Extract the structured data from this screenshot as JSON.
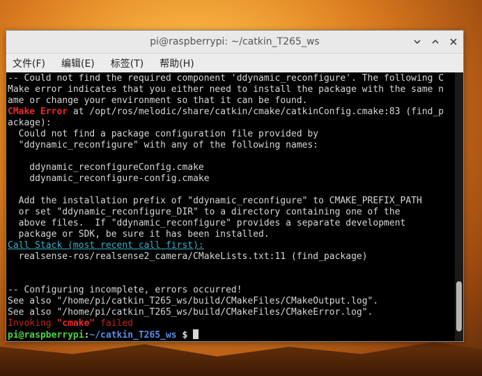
{
  "window": {
    "title": "pi@raspberrypi: ~/catkin_T265_ws",
    "controls": [
      "minimize-icon",
      "maximize-icon",
      "close-icon"
    ]
  },
  "menu": {
    "file": "文件(F)",
    "edit": "编辑(E)",
    "tabs": "标签(T)",
    "help": "帮助(H)"
  },
  "terminal": {
    "l1": "-- Could not find the required component 'ddynamic_reconfigure'. The following C",
    "l2": "Make error indicates that you either need to install the package with the same n",
    "l3": "ame or change your environment so that it can be found.",
    "l4_a": "CMake Error",
    "l4_b": " at /opt/ros/melodic/share/catkin/cmake/catkinConfig.cmake:83 (find_p",
    "l5": "ackage):",
    "l6": "  Could not find a package configuration file provided by",
    "l7": "  \"ddynamic_reconfigure\" with any of the following names:",
    "l8": "",
    "l9": "    ddynamic_reconfigureConfig.cmake",
    "l10": "    ddynamic_reconfigure-config.cmake",
    "l11": "",
    "l12": "  Add the installation prefix of \"ddynamic_reconfigure\" to CMAKE_PREFIX_PATH",
    "l13": "  or set \"ddynamic_reconfigure_DIR\" to a directory containing one of the",
    "l14": "  above files.  If \"ddynamic_reconfigure\" provides a separate development",
    "l15": "  package or SDK, be sure it has been installed.",
    "l16": "Call Stack (most recent call first):",
    "l17": "  realsense-ros/realsense2_camera/CMakeLists.txt:11 (find_package)",
    "l18": "",
    "l19": "",
    "l20": "-- Configuring incomplete, errors occurred!",
    "l21": "See also \"/home/pi/catkin_T265_ws/build/CMakeFiles/CMakeOutput.log\".",
    "l22": "See also \"/home/pi/catkin_T265_ws/build/CMakeFiles/CMakeError.log\".",
    "l23_a": "Invoking ",
    "l23_b": "\"cmake\"",
    "l23_c": " failed",
    "prompt_user": "pi@raspberrypi",
    "prompt_colon": ":",
    "prompt_path": "~/catkin_T265_ws",
    "prompt_symbol": " $ "
  },
  "colors": {
    "error_red": "#ef2929",
    "link_cyan": "#34b2c9",
    "prompt_green": "#4fd43d",
    "prompt_blue": "#5a8ce8"
  }
}
